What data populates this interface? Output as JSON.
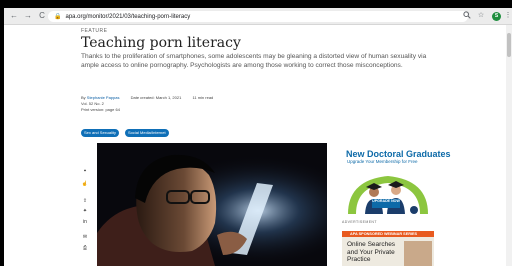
{
  "browser": {
    "url": "apa.org/monitor/2021/03/teaching-porn-literacy",
    "back_icon": "←",
    "forward_icon": "→",
    "reload_icon": "C",
    "avatar_letter": "S"
  },
  "article": {
    "kicker": "FEATURE",
    "title": "Teaching porn literacy",
    "summary": "Thanks to the proliferation of smartphones, some adolescents may be gleaning a distorted view of human sexuality via ample access to online pornography. Psychologists are among those working to correct those misconceptions.",
    "byline_prefix": "By ",
    "author": "Stephanie Pappas",
    "date_created": "Date created: March 1, 2021",
    "read_time": "11 min read",
    "volume": "Vol. 52 No. 2",
    "print_version": "Print version: page 64",
    "tags": [
      "Sex and Sexuality",
      "Social Media/Internet"
    ]
  },
  "ads": {
    "ad1_heading": "New Doctoral Graduates",
    "ad1_subheading": "Upgrade Your Membership for Free",
    "ad1_button": "UPGRADE NOW",
    "advertisement_label": "ADVERTISEMENT",
    "ad2_banner": "APA SPONSORED WEBINAR SERIES",
    "ad2_text": "Online Searches and Your Private Practice"
  },
  "colors": {
    "accent": "#0f6fb7",
    "ad_blue": "#0d6aa8",
    "ad_green": "#8cc63f",
    "ad_orange": "#e85a1f"
  }
}
